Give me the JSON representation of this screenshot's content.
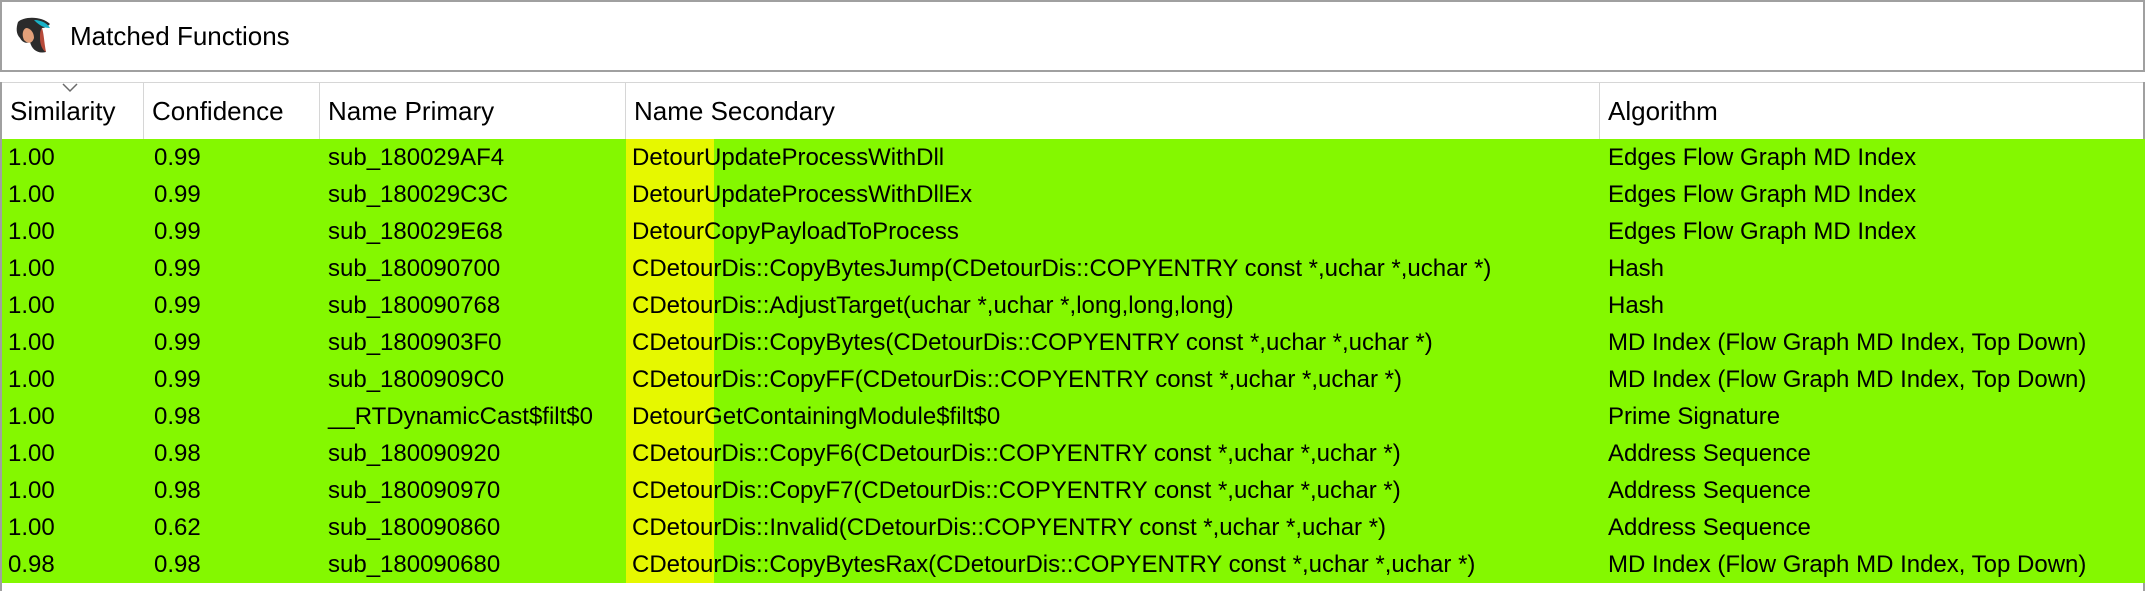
{
  "window": {
    "title": "Matched Functions",
    "icon": "app-logo-icon"
  },
  "table": {
    "columns": [
      "Similarity",
      "Confidence",
      "Name Primary",
      "Name Secondary",
      "Algorithm"
    ],
    "sorted_column": "Similarity",
    "row_color": "#84f800",
    "highlight_color": "#e6f800",
    "rows": [
      {
        "similarity": "1.00",
        "confidence": "0.99",
        "primary": "sub_180029AF4",
        "secondary_prefix": "Detour",
        "secondary_rest": "UpdateProcessWithDll",
        "algorithm": "Edges Flow Graph MD Index"
      },
      {
        "similarity": "1.00",
        "confidence": "0.99",
        "primary": "sub_180029C3C",
        "secondary_prefix": "Detour",
        "secondary_rest": "UpdateProcessWithDllEx",
        "algorithm": "Edges Flow Graph MD Index"
      },
      {
        "similarity": "1.00",
        "confidence": "0.99",
        "primary": "sub_180029E68",
        "secondary_prefix": "Detour",
        "secondary_rest": "CopyPayloadToProcess",
        "algorithm": "Edges Flow Graph MD Index"
      },
      {
        "similarity": "1.00",
        "confidence": "0.99",
        "primary": "sub_180090700",
        "secondary_prefix": "",
        "secondary_rest": "CDetourDis::CopyBytesJump(CDetourDis::COPYENTRY const *,uchar *,uchar *)",
        "algorithm": "Hash"
      },
      {
        "similarity": "1.00",
        "confidence": "0.99",
        "primary": "sub_180090768",
        "secondary_prefix": "",
        "secondary_rest": "CDetourDis::AdjustTarget(uchar *,uchar *,long,long,long)",
        "algorithm": "Hash"
      },
      {
        "similarity": "1.00",
        "confidence": "0.99",
        "primary": "sub_1800903F0",
        "secondary_prefix": "",
        "secondary_rest": "CDetourDis::CopyBytes(CDetourDis::COPYENTRY const *,uchar *,uchar *)",
        "algorithm": "MD Index (Flow Graph MD Index, Top Down)"
      },
      {
        "similarity": "1.00",
        "confidence": "0.99",
        "primary": "sub_1800909C0",
        "secondary_prefix": "",
        "secondary_rest": "CDetourDis::CopyFF(CDetourDis::COPYENTRY const *,uchar *,uchar *)",
        "algorithm": "MD Index (Flow Graph MD Index, Top Down)"
      },
      {
        "similarity": "1.00",
        "confidence": "0.98",
        "primary": "__RTDynamicCast$filt$0",
        "secondary_prefix": "Detour",
        "secondary_rest": "GetContainingModule$filt$0",
        "algorithm": "Prime Signature"
      },
      {
        "similarity": "1.00",
        "confidence": "0.98",
        "primary": "sub_180090920",
        "secondary_prefix": "",
        "secondary_rest": "CDetourDis::CopyF6(CDetourDis::COPYENTRY const *,uchar *,uchar *)",
        "algorithm": "Address Sequence"
      },
      {
        "similarity": "1.00",
        "confidence": "0.98",
        "primary": "sub_180090970",
        "secondary_prefix": "",
        "secondary_rest": "CDetourDis::CopyF7(CDetourDis::COPYENTRY const *,uchar *,uchar *)",
        "algorithm": "Address Sequence"
      },
      {
        "similarity": "1.00",
        "confidence": "0.62",
        "primary": "sub_180090860",
        "secondary_prefix": "",
        "secondary_rest": "CDetourDis::Invalid(CDetourDis::COPYENTRY const *,uchar *,uchar *)",
        "algorithm": "Address Sequence"
      },
      {
        "similarity": "0.98",
        "confidence": "0.98",
        "primary": "sub_180090680",
        "secondary_prefix": "",
        "secondary_rest": "CDetourDis::CopyBytesRax(CDetourDis::COPYENTRY const *,uchar *,uchar *)",
        "algorithm": "MD Index (Flow Graph MD Index, Top Down)"
      }
    ]
  }
}
